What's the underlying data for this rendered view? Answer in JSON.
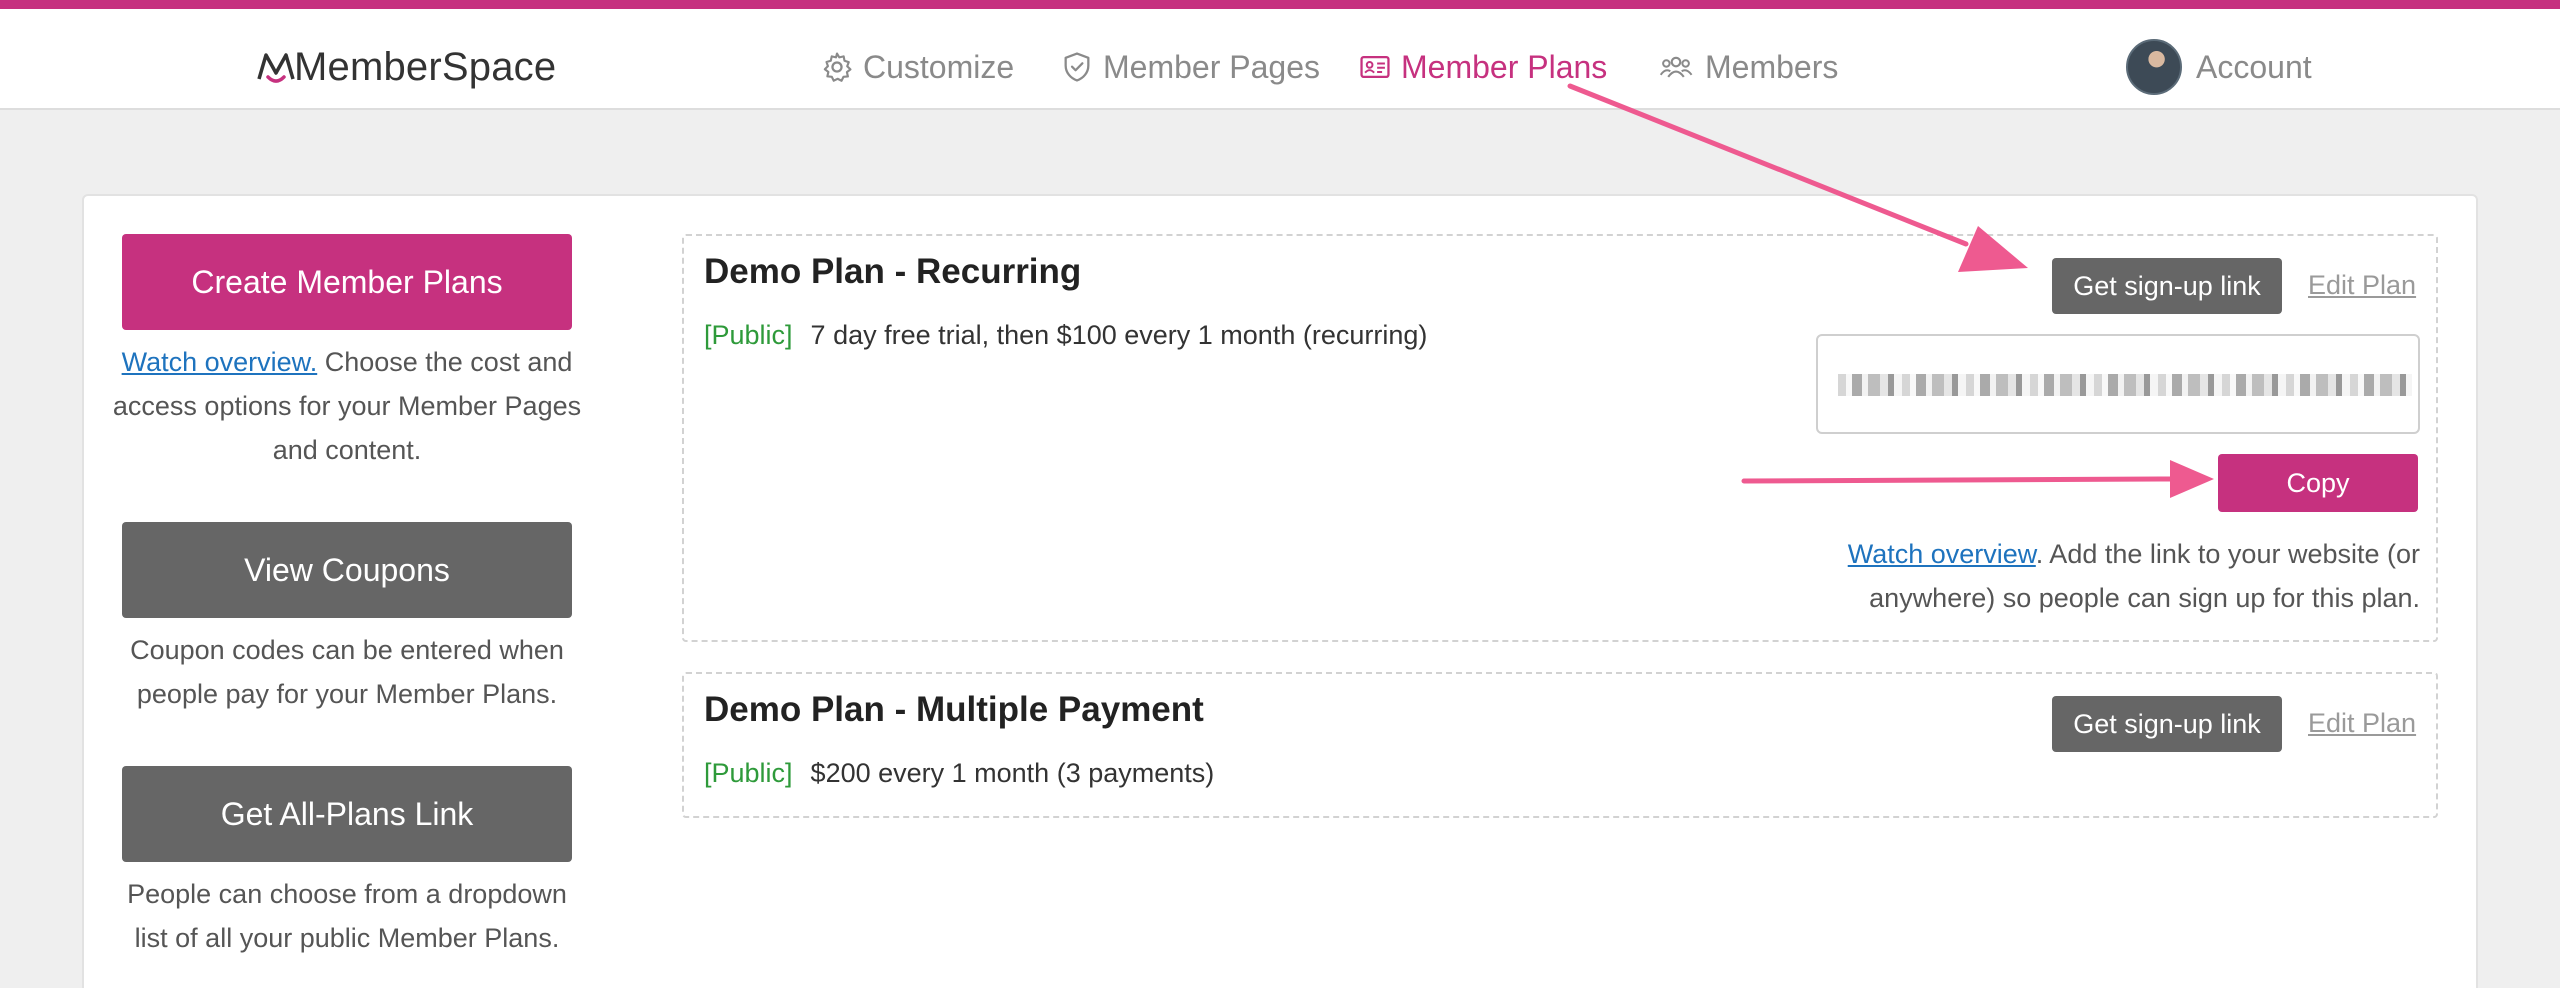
{
  "brand": {
    "name": "MemberSpace",
    "accent": "#c6317f"
  },
  "nav": {
    "items": [
      {
        "label": "Customize",
        "icon": "gear-icon"
      },
      {
        "label": "Member Pages",
        "icon": "shield-check-icon"
      },
      {
        "label": "Member Plans",
        "icon": "id-card-icon",
        "active": true
      },
      {
        "label": "Members",
        "icon": "users-icon"
      }
    ],
    "account": "Account"
  },
  "sidebar": {
    "create": {
      "button": "Create Member Plans",
      "link": "Watch overview.",
      "text": " Choose the cost and access options for your Member Pages and content."
    },
    "coupons": {
      "button": "View Coupons",
      "text": "Coupon codes can be entered when people pay for your Member Plans."
    },
    "all_plans": {
      "button": "Get All-Plans Link",
      "text": "People can choose from a dropdown list of all your public Member Plans."
    }
  },
  "plans": [
    {
      "title": "Demo Plan - Recurring",
      "tag": "[Public]",
      "description": "7 day free trial, then $100 every 1 month (recurring)",
      "signup_label": "Get sign-up link",
      "edit_label": "Edit Plan",
      "copy_label": "Copy",
      "help_link": "Watch overview",
      "help_text": ". Add the link to your website (or anywhere) so people can sign up for this plan."
    },
    {
      "title": "Demo Plan - Multiple Payment",
      "tag": "[Public]",
      "description": "$200 every 1 month (3 payments)",
      "signup_label": "Get sign-up link",
      "edit_label": "Edit Plan"
    }
  ]
}
